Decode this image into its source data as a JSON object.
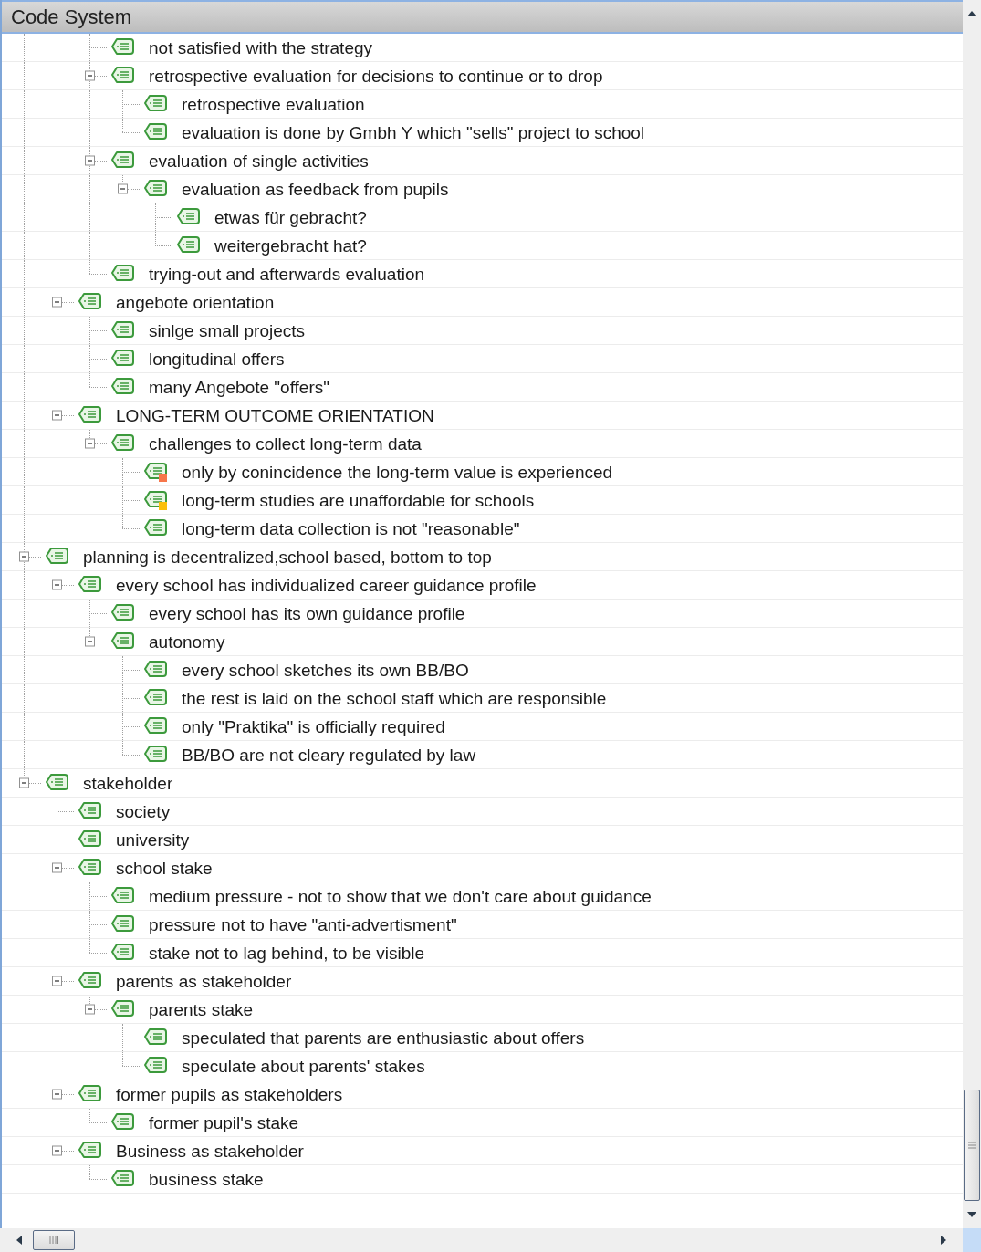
{
  "panel": {
    "title": "Code System"
  },
  "tree": [
    {
      "children": [
        {
          "children": [
            {
              "label": "not satisfied with the strategy"
            },
            {
              "label": "retrospective evaluation for decisions to continue or to drop",
              "expanded": true,
              "children": [
                {
                  "label": "retrospective evaluation"
                },
                {
                  "label": "evaluation is done by Gmbh Y which \"sells\" project to school"
                }
              ]
            },
            {
              "label": "evaluation of single activities",
              "expanded": true,
              "children": [
                {
                  "label": "evaluation as feedback from pupils",
                  "expanded": true,
                  "children": [
                    {
                      "label": "etwas für gebracht?"
                    },
                    {
                      "label": "weitergebracht hat?"
                    }
                  ]
                }
              ]
            },
            {
              "label": "trying-out and afterwards evaluation"
            }
          ]
        },
        {
          "label": "angebote orientation",
          "expanded": true,
          "children": [
            {
              "label": "sinlge small projects"
            },
            {
              "label": "longitudinal offers"
            },
            {
              "label": "many Angebote \"offers\""
            }
          ]
        },
        {
          "label": "LONG-TERM OUTCOME ORIENTATION",
          "expanded": true,
          "children": [
            {
              "label": "challenges to collect long-term data",
              "expanded": true,
              "children": [
                {
                  "label": "only by conincidence the long-term value is experienced",
                  "color": "#f7764a"
                },
                {
                  "label": "long-term studies are unaffordable for schools",
                  "color": "#fbbf0a"
                },
                {
                  "label": "long-term data collection is not \"reasonable\""
                }
              ]
            }
          ]
        }
      ]
    },
    {
      "label": "planning is decentralized,school based, bottom to top",
      "expanded": true,
      "children": [
        {
          "label": "every school has individualized career guidance profile",
          "expanded": true,
          "children": [
            {
              "label": "every school has its own guidance profile"
            },
            {
              "label": "autonomy",
              "expanded": true,
              "children": [
                {
                  "label": "every school sketches its own BB/BO"
                },
                {
                  "label": "the rest is laid on the school staff which are responsible"
                },
                {
                  "label": "only \"Praktika\" is officially required"
                },
                {
                  "label": "BB/BO are not cleary regulated by law"
                }
              ]
            }
          ]
        }
      ]
    },
    {
      "label": "stakeholder",
      "expanded": true,
      "children": [
        {
          "label": "society"
        },
        {
          "label": "university"
        },
        {
          "label": "school stake",
          "expanded": true,
          "children": [
            {
              "label": "medium pressure - not to show that we don't care about guidance"
            },
            {
              "label": "pressure not to have \"anti-advertisment\""
            },
            {
              "label": "stake not to lag behind, to be visible"
            }
          ]
        },
        {
          "label": "parents as stakeholder",
          "expanded": true,
          "children": [
            {
              "label": "parents stake",
              "expanded": true,
              "children": [
                {
                  "label": "speculated that parents are enthusiastic about offers"
                },
                {
                  "label": "speculate about parents' stakes"
                }
              ]
            }
          ]
        },
        {
          "label": "former pupils as stakeholders",
          "expanded": true,
          "children": [
            {
              "label": "former pupil's stake"
            }
          ]
        },
        {
          "label": "Business as stakeholder",
          "expanded": true,
          "children": [
            {
              "label": "business stake"
            }
          ]
        }
      ]
    }
  ]
}
